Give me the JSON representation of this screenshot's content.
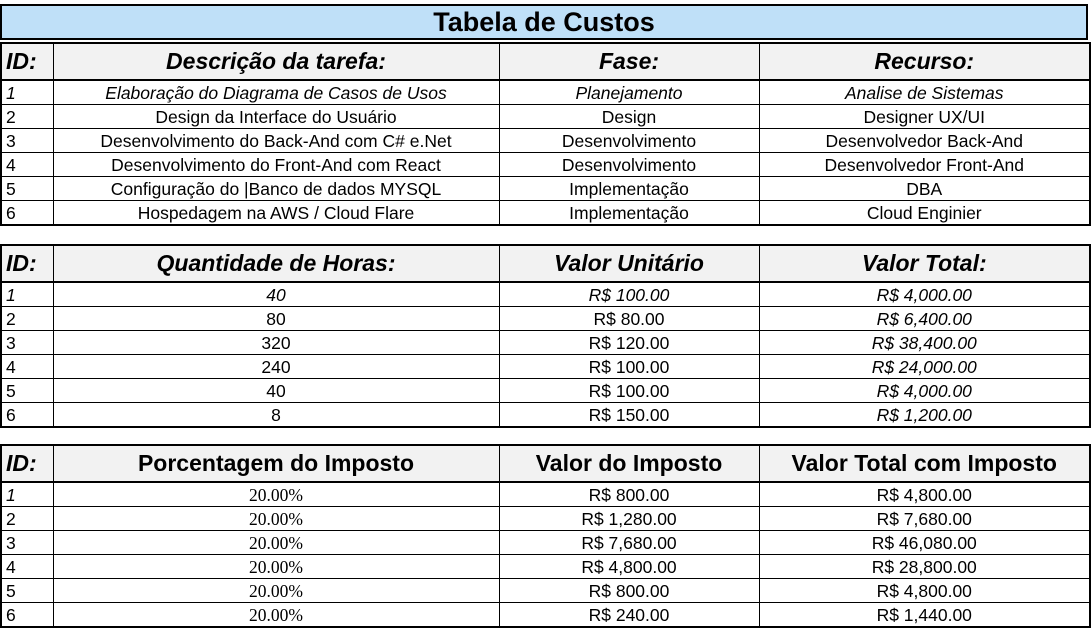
{
  "title": "Tabela de Custos",
  "table1": {
    "headers": [
      "ID:",
      "Descrição da tarefa:",
      "Fase:",
      "Recurso:"
    ],
    "rows": [
      [
        "1",
        "Elaboração do Diagrama de Casos de Usos",
        "Planejamento",
        "Analise de Sistemas"
      ],
      [
        "2",
        "Design da Interface do Usuário",
        "Design",
        "Designer UX/UI"
      ],
      [
        "3",
        "Desenvolvimento do Back-And com C# e.Net",
        "Desenvolvimento",
        "Desenvolvedor Back-And"
      ],
      [
        "4",
        "Desenvolvimento do Front-And com React",
        "Desenvolvimento",
        "Desenvolvedor Front-And"
      ],
      [
        "5",
        "Configuração do |Banco de dados MYSQL",
        "Implementação",
        "DBA"
      ],
      [
        "6",
        "Hospedagem na AWS / Cloud Flare",
        "Implementação",
        "Cloud Enginier"
      ]
    ]
  },
  "table2": {
    "headers": [
      "ID:",
      "Quantidade de Horas:",
      "Valor Unitário",
      "Valor Total:"
    ],
    "rows": [
      [
        "1",
        "40",
        "R$ 100.00",
        "R$ 4,000.00"
      ],
      [
        "2",
        "80",
        "R$ 80.00",
        "R$ 6,400.00"
      ],
      [
        "3",
        "320",
        "R$ 120.00",
        "R$ 38,400.00"
      ],
      [
        "4",
        "240",
        "R$ 100.00",
        "R$ 24,000.00"
      ],
      [
        "5",
        "40",
        "R$ 100.00",
        "R$ 4,000.00"
      ],
      [
        "6",
        "8",
        "R$ 150.00",
        "R$ 1,200.00"
      ]
    ]
  },
  "table3": {
    "headers": [
      "ID:",
      "Porcentagem do Imposto",
      "Valor do Imposto",
      "Valor Total com Imposto"
    ],
    "rows": [
      [
        "1",
        "20.00%",
        "R$ 800.00",
        "R$ 4,800.00"
      ],
      [
        "2",
        "20.00%",
        "R$ 1,280.00",
        "R$ 7,680.00"
      ],
      [
        "3",
        "20.00%",
        "R$ 7,680.00",
        "R$ 46,080.00"
      ],
      [
        "4",
        "20.00%",
        "R$ 4,800.00",
        "R$ 28,800.00"
      ],
      [
        "5",
        "20.00%",
        "R$ 800.00",
        "R$ 4,800.00"
      ],
      [
        "6",
        "20.00%",
        "R$ 240.00",
        "R$ 1,440.00"
      ]
    ]
  }
}
